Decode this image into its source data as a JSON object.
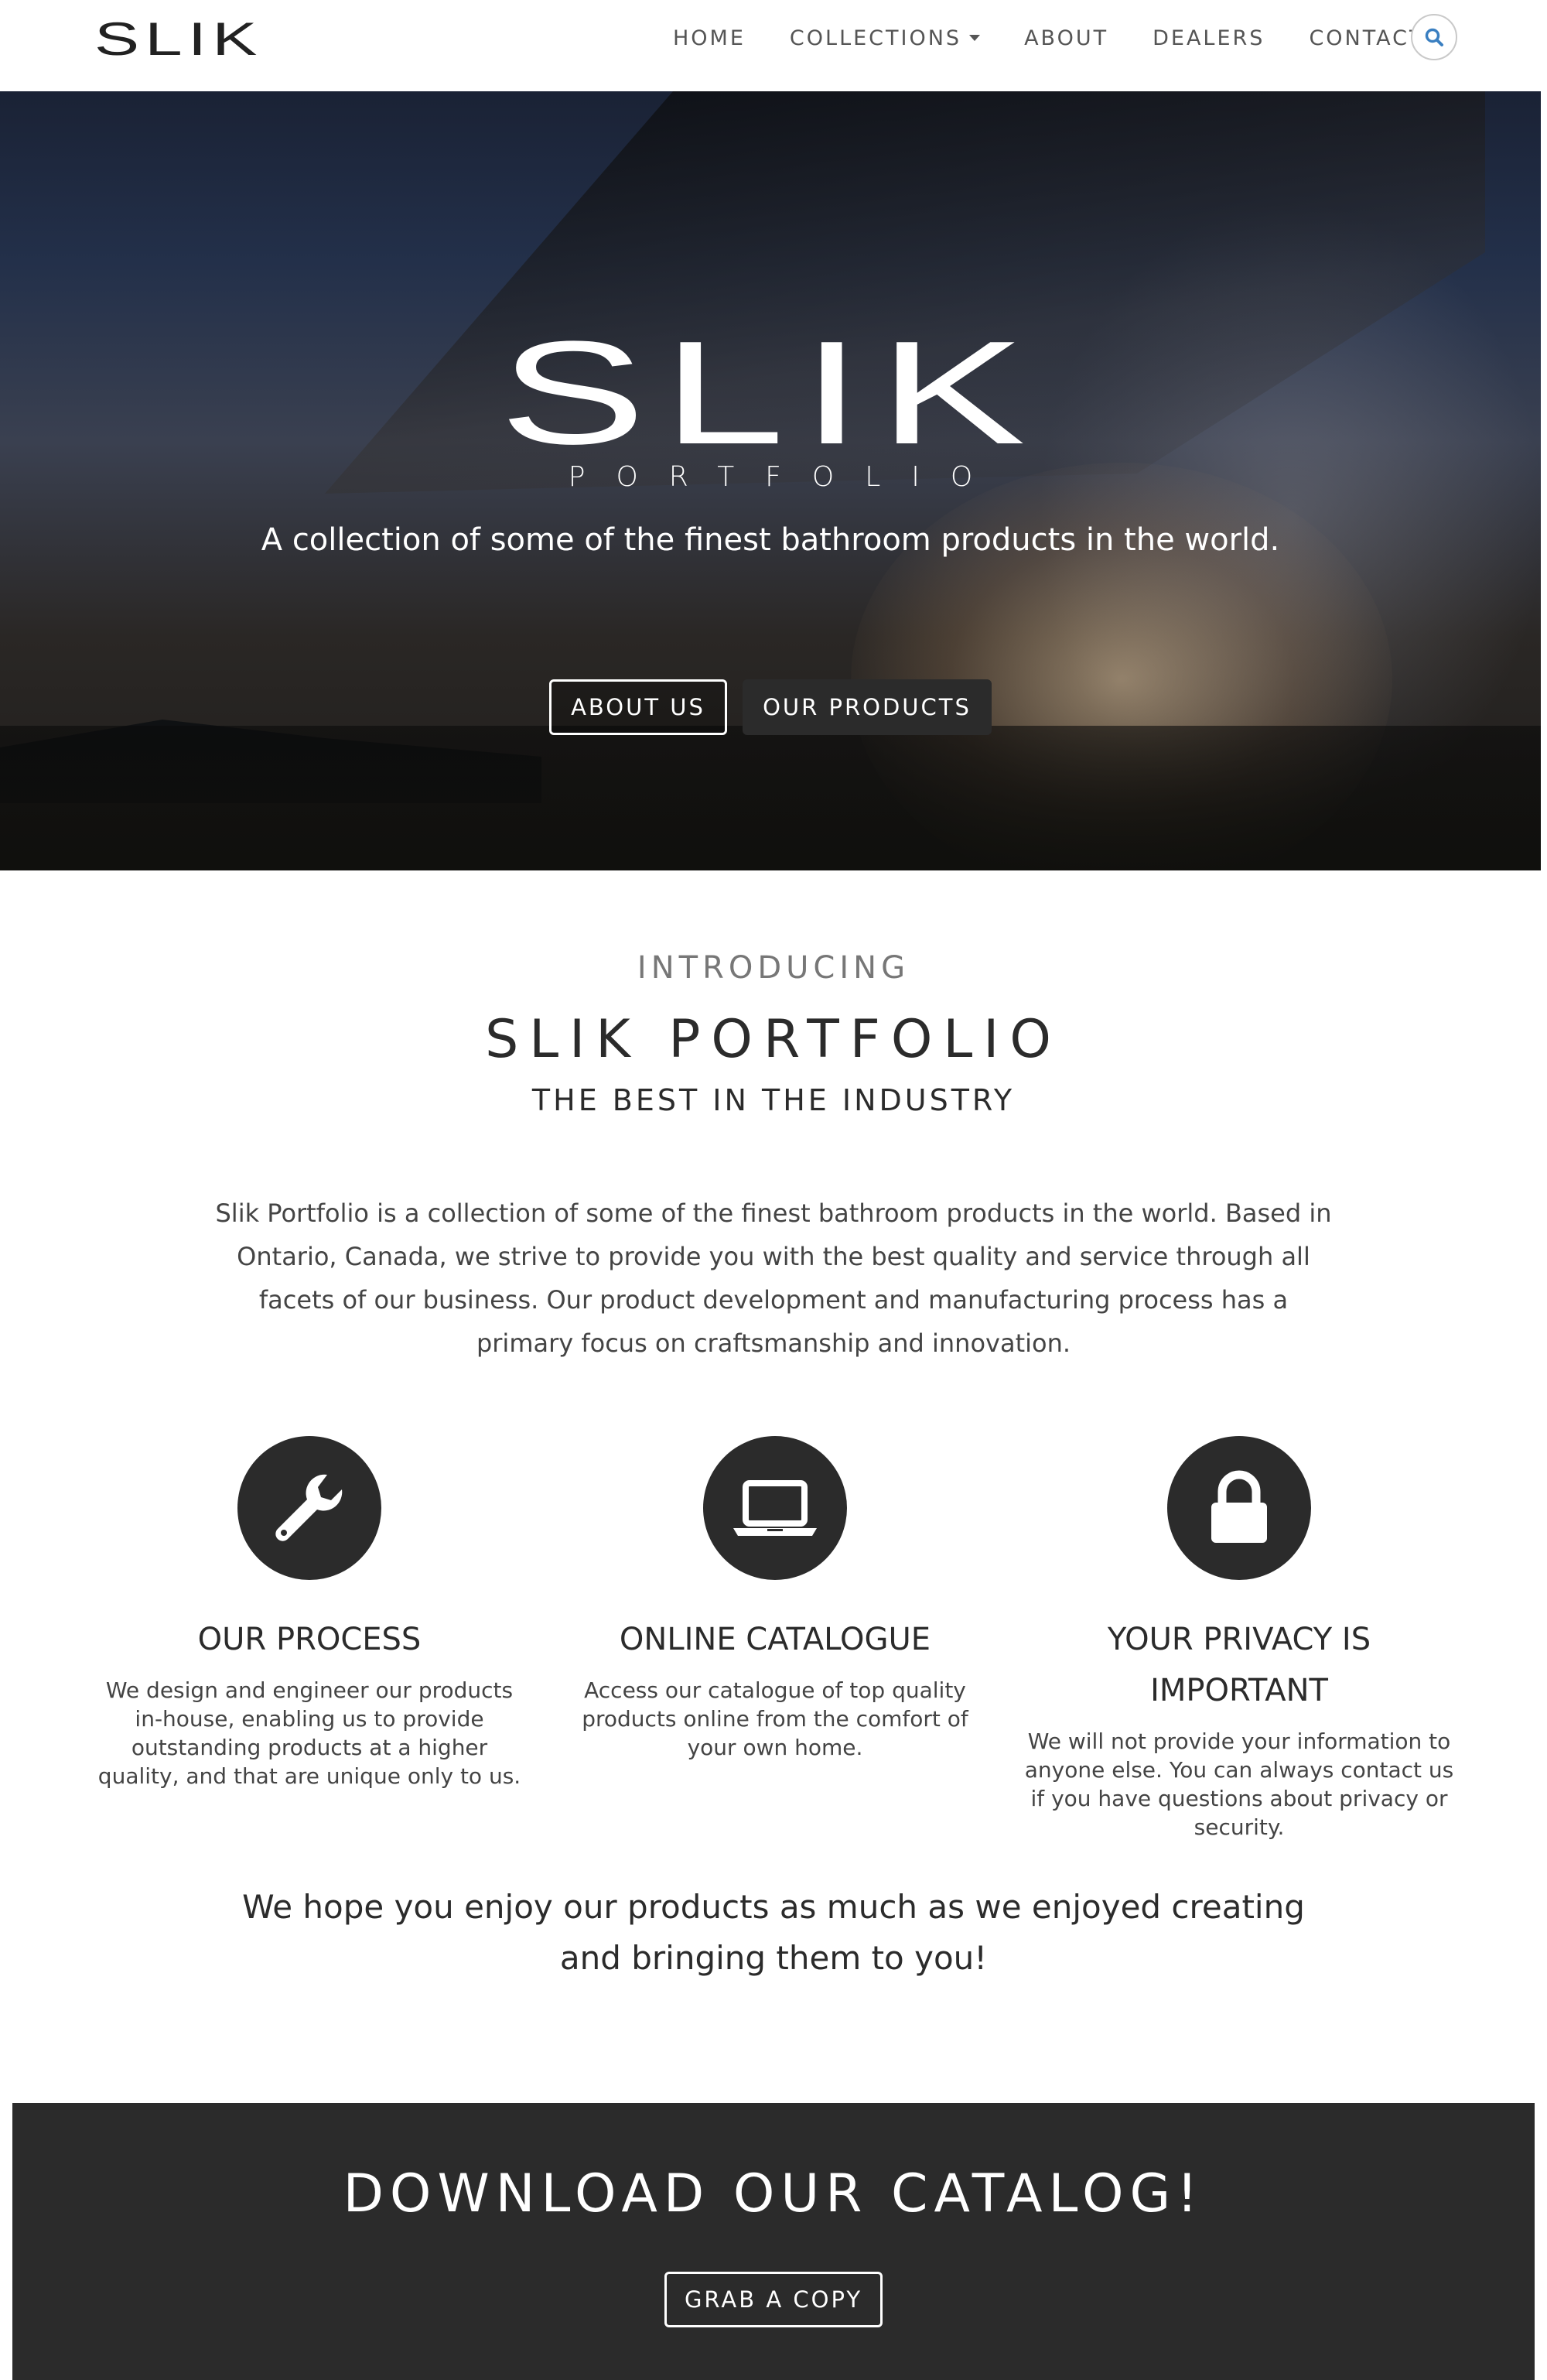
{
  "brand": {
    "logo_text": "SLIK"
  },
  "nav": {
    "items": [
      {
        "label": "HOME"
      },
      {
        "label": "COLLECTIONS"
      },
      {
        "label": "ABOUT"
      },
      {
        "label": "DEALERS"
      },
      {
        "label": "CONTACT"
      }
    ]
  },
  "hero": {
    "logo": "SLIK",
    "logo_sub": "PORTFOLIO",
    "tagline": "A collection of some of the finest bathroom products in the world.",
    "btn_about": "ABOUT US",
    "btn_products": "OUR PRODUCTS"
  },
  "intro": {
    "kicker": "INTRODUCING",
    "title": "SLIK PORTFOLIO",
    "subtitle": "THE BEST IN THE INDUSTRY",
    "body": "Slik Portfolio is a collection of some of the finest bathroom products in the world. Based in Ontario, Canada, we strive to provide you with the best quality and service through all facets of our business. Our product development and manufacturing process has a primary focus on craftsmanship and innovation."
  },
  "features": [
    {
      "icon": "wrench-icon",
      "title": "OUR PROCESS",
      "text": "We design and engineer our products in-house, enabling us to provide outstanding products at a higher quality, and that are unique only to us."
    },
    {
      "icon": "laptop-icon",
      "title": "ONLINE CATALOGUE",
      "text": "Access our catalogue of top quality products online from the comfort of your own home."
    },
    {
      "icon": "lock-icon",
      "title": "YOUR PRIVACY IS IMPORTANT",
      "text": "We will not provide your information to anyone else. You can always contact us if you have questions about privacy or security."
    }
  ],
  "closing": "We hope you enjoy our products as much as we enjoyed creating and bringing them to you!",
  "cta": {
    "title": "DOWNLOAD OUR CATALOG!",
    "button": "GRAB A COPY"
  },
  "colors": {
    "dark": "#2b2b2b",
    "search_icon": "#3a7fc1"
  }
}
